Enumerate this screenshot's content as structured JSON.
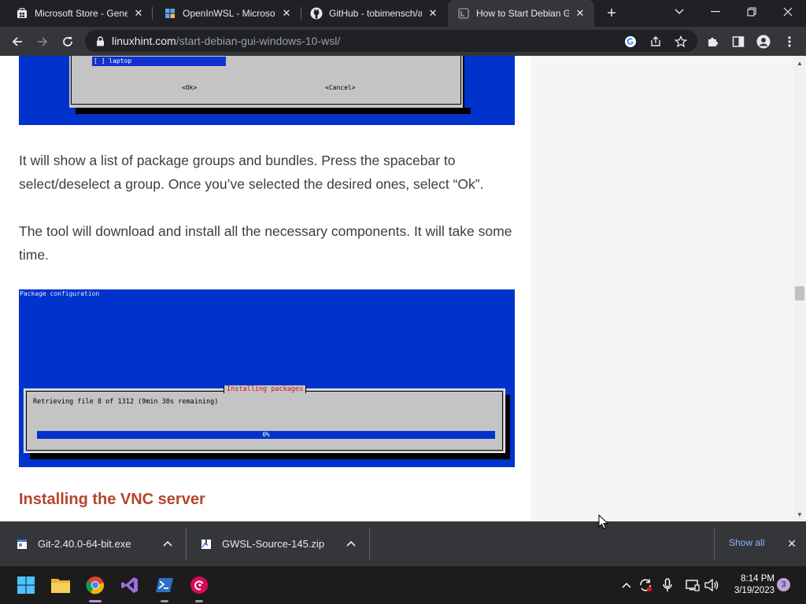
{
  "browser": {
    "tabs": [
      {
        "title": "Microsoft Store - Gene",
        "icon": "store-icon"
      },
      {
        "title": "OpenInWSL - Microsoft",
        "icon": "store-icon"
      },
      {
        "title": "GitHub - tobimensch/a",
        "icon": "github-icon"
      },
      {
        "title": "How to Start Debian GU",
        "icon": "linuxhint-icon",
        "active": true
      }
    ],
    "url_domain": "linuxhint.com",
    "url_path": "/start-debian-gui-windows-10-wsl/"
  },
  "article": {
    "screenshot1": {
      "list_item": "[ ] laptop",
      "ok_button": "<Ok>",
      "cancel_button": "<Cancel>"
    },
    "paragraph1": "It will show a list of package groups and bundles. Press the spacebar to select/deselect a group. Once you’ve selected the desired ones, select “Ok”.",
    "paragraph2": "The tool will download and install all the necessary components. It will take some time.",
    "screenshot2": {
      "header": "Package configuration",
      "box_title": "Installing packages",
      "message": "Retrieving file 8 of 1312 (9min 30s remaining)",
      "progress_label": "0%",
      "progress_fraction": 0
    },
    "heading": "Installing the VNC server"
  },
  "downloads": {
    "items": [
      {
        "name": "Git-2.40.0-64-bit.exe"
      },
      {
        "name": "GWSL-Source-145.zip"
      }
    ],
    "show_all": "Show all"
  },
  "taskbar": {
    "time": "8:14 PM",
    "date": "3/19/2023",
    "notification_count": "3"
  },
  "colors": {
    "terminal_blue": "#0033cc",
    "heading_red": "#b5452d",
    "link_blue": "#8ab4f8"
  }
}
